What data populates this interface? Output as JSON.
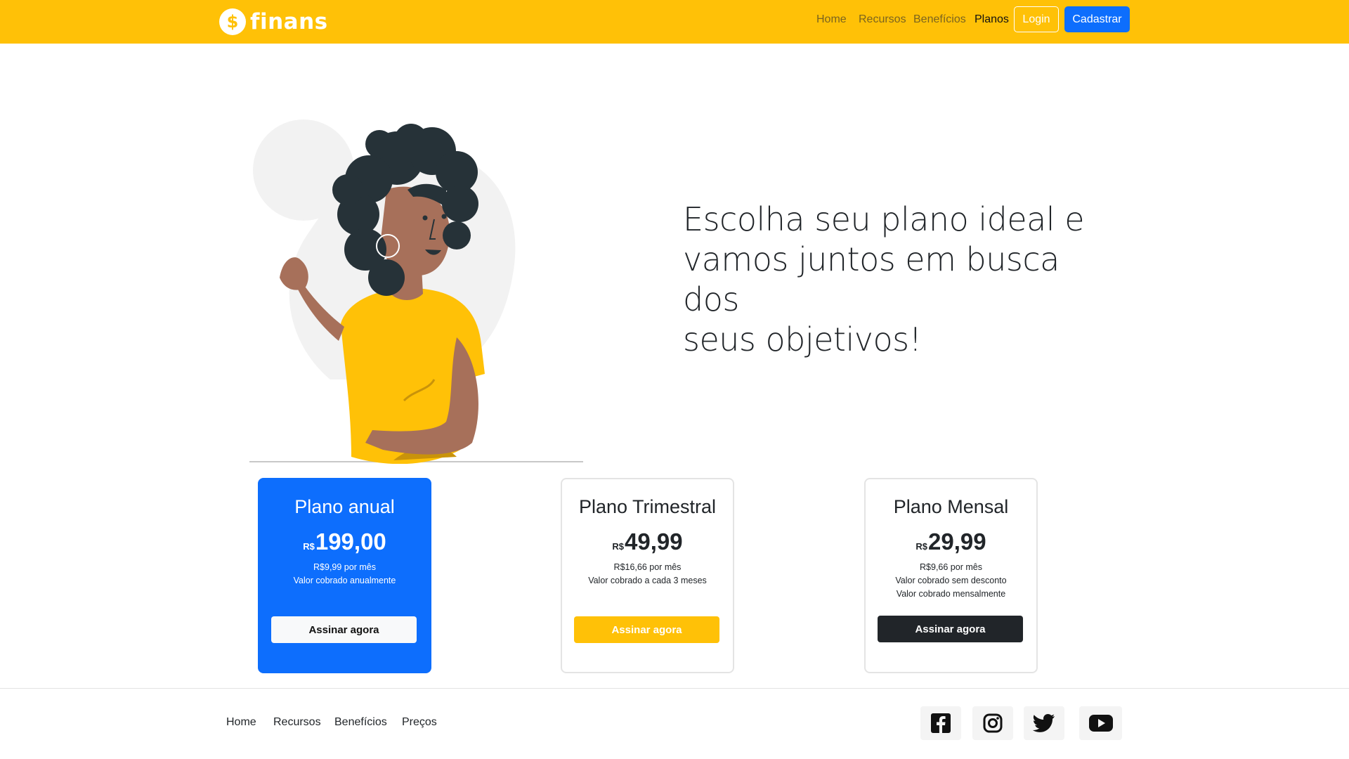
{
  "brand": {
    "name": "finans",
    "icon": "dollar-icon",
    "icon_glyph": "$"
  },
  "colors": {
    "navbar": "#ffc107",
    "primary": "#0d6efd",
    "dark": "#212529",
    "light": "#f8f9fa"
  },
  "nav": {
    "links": [
      "Home",
      "Recursos",
      "Benefícios",
      "Planos"
    ],
    "active": "Planos",
    "login_label": "Login",
    "signup_label": "Cadastrar"
  },
  "hero": {
    "title_lines": [
      "Escolha seu plano ideal e",
      "vamos juntos em busca dos",
      "seus objetivos!"
    ],
    "illustration": "woman-illustration"
  },
  "plans": [
    {
      "title": "Plano anual",
      "currency": "R$",
      "price": "199,00",
      "lines": [
        "R$9,99 por mês",
        "Valor cobrado anualmente"
      ],
      "button": "Assinar agora"
    },
    {
      "title": "Plano Trimestral",
      "currency": "R$",
      "price": "49,99",
      "lines": [
        "R$16,66 por mês",
        "Valor cobrado a cada 3 meses"
      ],
      "button": "Assinar agora"
    },
    {
      "title": "Plano Mensal",
      "currency": "R$",
      "price": "29,99",
      "lines": [
        "R$9,66 por mês",
        "Valor cobrado sem desconto",
        "Valor cobrado mensalmente"
      ],
      "button": "Assinar agora"
    }
  ],
  "footer": {
    "links": [
      "Home",
      "Recursos",
      "Benefícios",
      "Preços"
    ],
    "social": [
      "facebook-icon",
      "instagram-icon",
      "twitter-icon",
      "youtube-icon"
    ]
  }
}
